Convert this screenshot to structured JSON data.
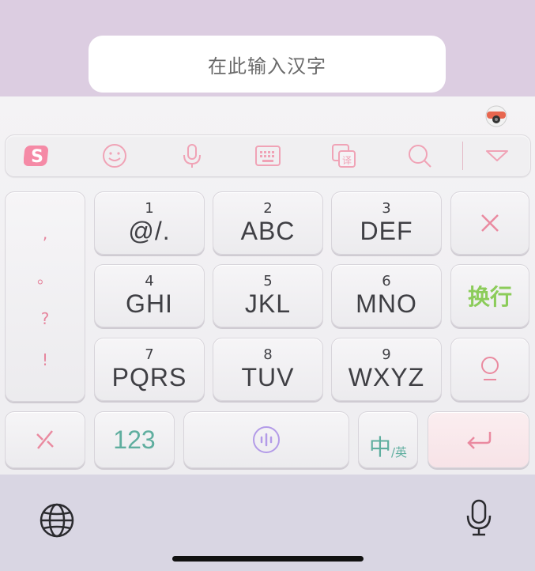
{
  "input": {
    "placeholder": "在此输入汉字"
  },
  "toolbar": {
    "icons": [
      "sogou-logo-icon",
      "emoji-icon",
      "voice-icon",
      "keyboard-icon",
      "translate-icon",
      "search-icon",
      "collapse-icon"
    ]
  },
  "keys": {
    "punctuation": [
      ",",
      "。",
      "?",
      "!"
    ],
    "k1": {
      "num": "1",
      "letters": "@/."
    },
    "k2": {
      "num": "2",
      "letters": "ABC"
    },
    "k3": {
      "num": "3",
      "letters": "DEF"
    },
    "k4": {
      "num": "4",
      "letters": "GHI"
    },
    "k5": {
      "num": "5",
      "letters": "JKL"
    },
    "k6": {
      "num": "6",
      "letters": "MNO"
    },
    "k7": {
      "num": "7",
      "letters": "PQRS"
    },
    "k8": {
      "num": "8",
      "letters": "TUV"
    },
    "k9": {
      "num": "9",
      "letters": "WXYZ"
    },
    "newline": "换行",
    "numbers": "123",
    "lang_main": "中",
    "lang_sub": "/英"
  },
  "colors": {
    "accent_pink": "#ea8aa0",
    "accent_green": "#8ccc5a",
    "accent_teal": "#5fae9f",
    "accent_purple": "#b39be8"
  }
}
